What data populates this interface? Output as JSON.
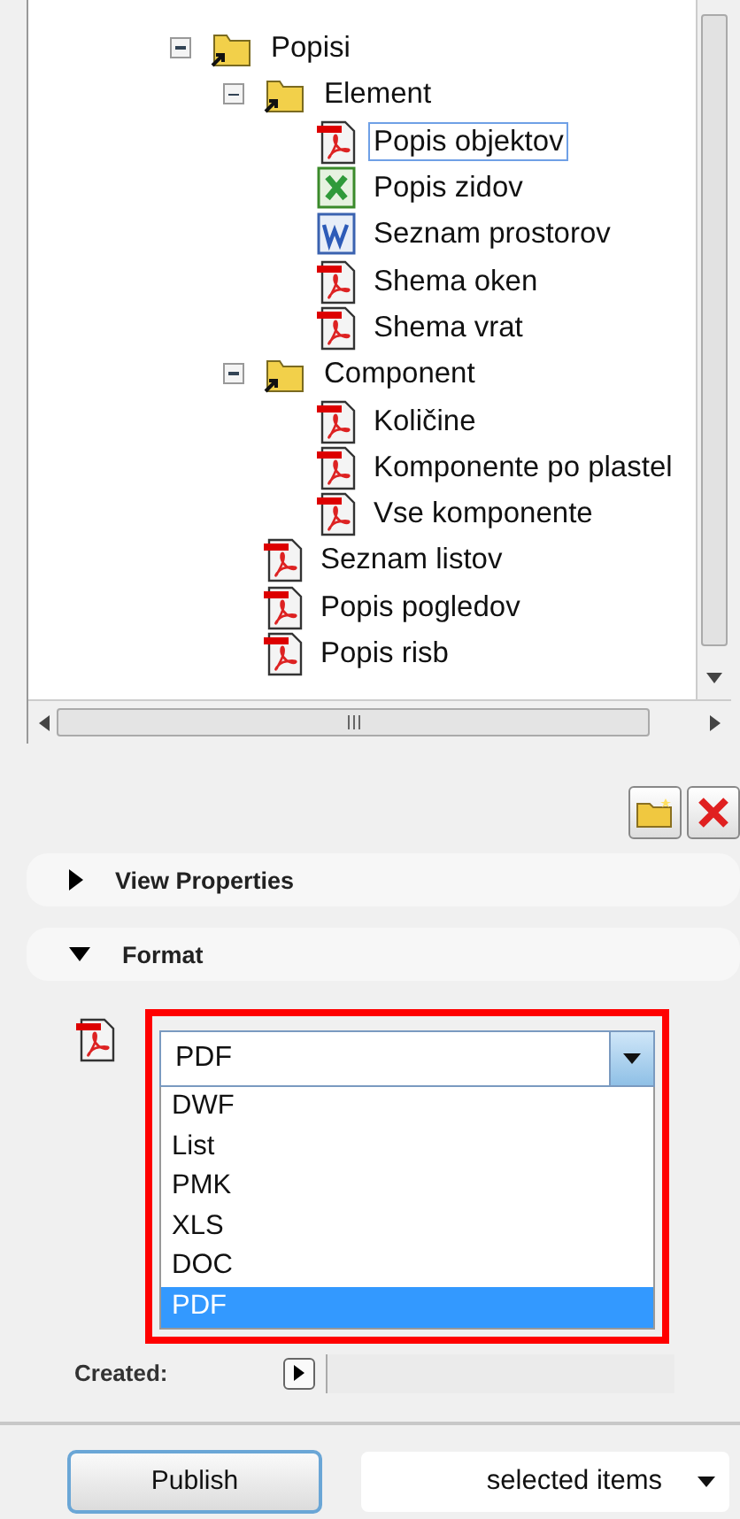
{
  "tree": {
    "items": [
      {
        "label": "Popisi",
        "kind": "folder",
        "expanded": true,
        "selected": false,
        "children": [
          {
            "label": "Element",
            "kind": "folder",
            "expanded": true,
            "selected": false,
            "children": [
              {
                "label": "Popis objektov",
                "kind": "pdf",
                "selected": true
              },
              {
                "label": "Popis zidov",
                "kind": "xls",
                "selected": false
              },
              {
                "label": "Seznam prostorov",
                "kind": "doc",
                "selected": false
              },
              {
                "label": "Shema oken",
                "kind": "pdf",
                "selected": false
              },
              {
                "label": "Shema vrat",
                "kind": "pdf",
                "selected": false
              }
            ]
          },
          {
            "label": "Component",
            "kind": "folder",
            "expanded": true,
            "selected": false,
            "children": [
              {
                "label": "Količine",
                "kind": "pdf",
                "selected": false
              },
              {
                "label": "Komponente po plastel",
                "kind": "pdf",
                "selected": false
              },
              {
                "label": "Vse komponente",
                "kind": "pdf",
                "selected": false
              }
            ]
          },
          {
            "label": "Seznam listov",
            "kind": "pdf",
            "selected": false
          },
          {
            "label": "Popis pogledov",
            "kind": "pdf",
            "selected": false
          },
          {
            "label": "Popis risb",
            "kind": "pdf",
            "selected": false
          }
        ]
      }
    ]
  },
  "sections": [
    {
      "title": "View Properties",
      "expanded": false
    },
    {
      "title": "Format",
      "expanded": true
    }
  ],
  "format": {
    "value": "PDF",
    "options": [
      {
        "label": "DWF",
        "selected": false
      },
      {
        "label": "List",
        "selected": false
      },
      {
        "label": "PMK",
        "selected": false
      },
      {
        "label": "XLS",
        "selected": false
      },
      {
        "label": "DOC",
        "selected": false
      },
      {
        "label": "PDF",
        "selected": true
      }
    ],
    "created_label": "Created:"
  },
  "publish": {
    "button": "Publish",
    "scope": "selected items"
  }
}
